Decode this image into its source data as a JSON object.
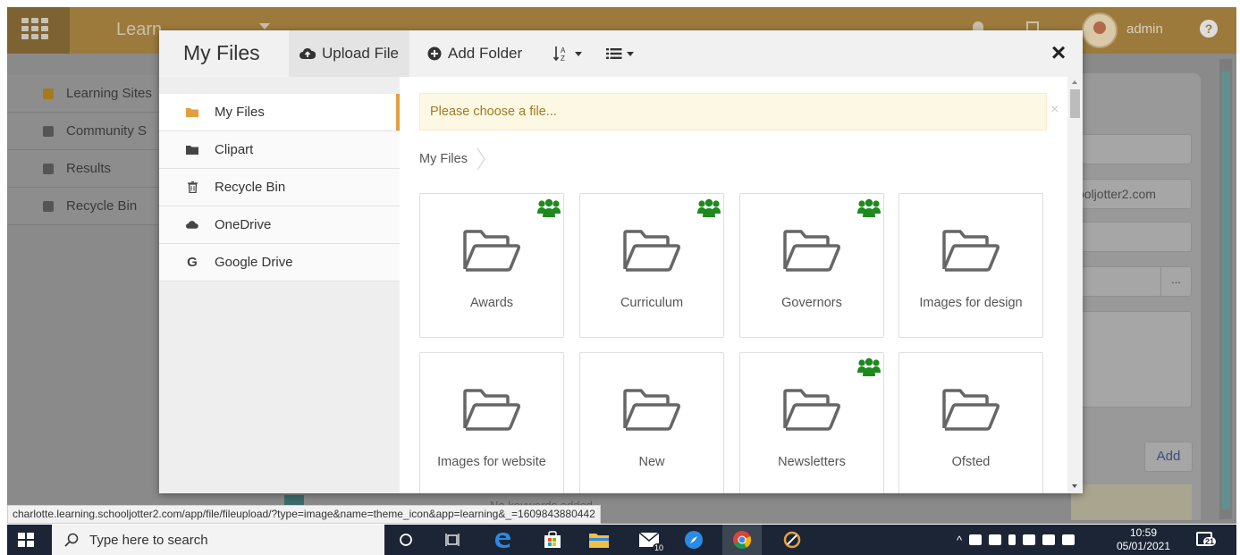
{
  "background_app": {
    "nav_tab": "Learn",
    "user": "admin",
    "help": "?",
    "sidebar": [
      {
        "label": "Learning Sites",
        "icon": "book-icon"
      },
      {
        "label": "Community S",
        "icon": "globe-icon"
      },
      {
        "label": "Results",
        "icon": "bar-chart-icon"
      },
      {
        "label": "Recycle Bin",
        "icon": "trash-icon"
      }
    ],
    "email_field_value": "ooljotter2.com",
    "more_button": "...",
    "add_button": "Add",
    "no_records_text": "No keywords added"
  },
  "modal": {
    "title": "My Files",
    "upload_label": "Upload File",
    "add_folder_label": "Add Folder",
    "close": "×",
    "sidebar": [
      {
        "label": "My Files",
        "icon": "folder-icon",
        "active": true
      },
      {
        "label": "Clipart",
        "icon": "folder-icon",
        "active": false
      },
      {
        "label": "Recycle Bin",
        "icon": "trash-icon",
        "active": false
      },
      {
        "label": "OneDrive",
        "icon": "cloud-icon",
        "active": false
      },
      {
        "label": "Google Drive",
        "icon": "google-icon",
        "glyph": "G",
        "active": false
      }
    ],
    "alert_text": "Please choose a file...",
    "alert_close": "×",
    "breadcrumb": [
      "My Files"
    ],
    "folders": [
      {
        "name": "Awards",
        "shared": true
      },
      {
        "name": "Curriculum",
        "shared": true
      },
      {
        "name": "Governors",
        "shared": true
      },
      {
        "name": "Images for design",
        "shared": false
      },
      {
        "name": "Images for website",
        "shared": false
      },
      {
        "name": "New",
        "shared": false
      },
      {
        "name": "Newsletters",
        "shared": true
      },
      {
        "name": "Ofsted",
        "shared": false
      }
    ]
  },
  "status_url": "charlotte.learning.schooljotter2.com/app/file/fileupload/?type=image&name=theme_icon&app=learning&_=1609843880442",
  "taskbar": {
    "search_placeholder": "Type here to search",
    "mail_badge": "10",
    "time": "10:59",
    "date": "05/01/2021",
    "notifications": "21"
  },
  "colors": {
    "brand_gold": "#9c7a3c",
    "active_accent": "#e0a040",
    "alert_bg": "#fcf8e3",
    "alert_text": "#a07a28",
    "shared_icon": "#1e8a1e"
  }
}
